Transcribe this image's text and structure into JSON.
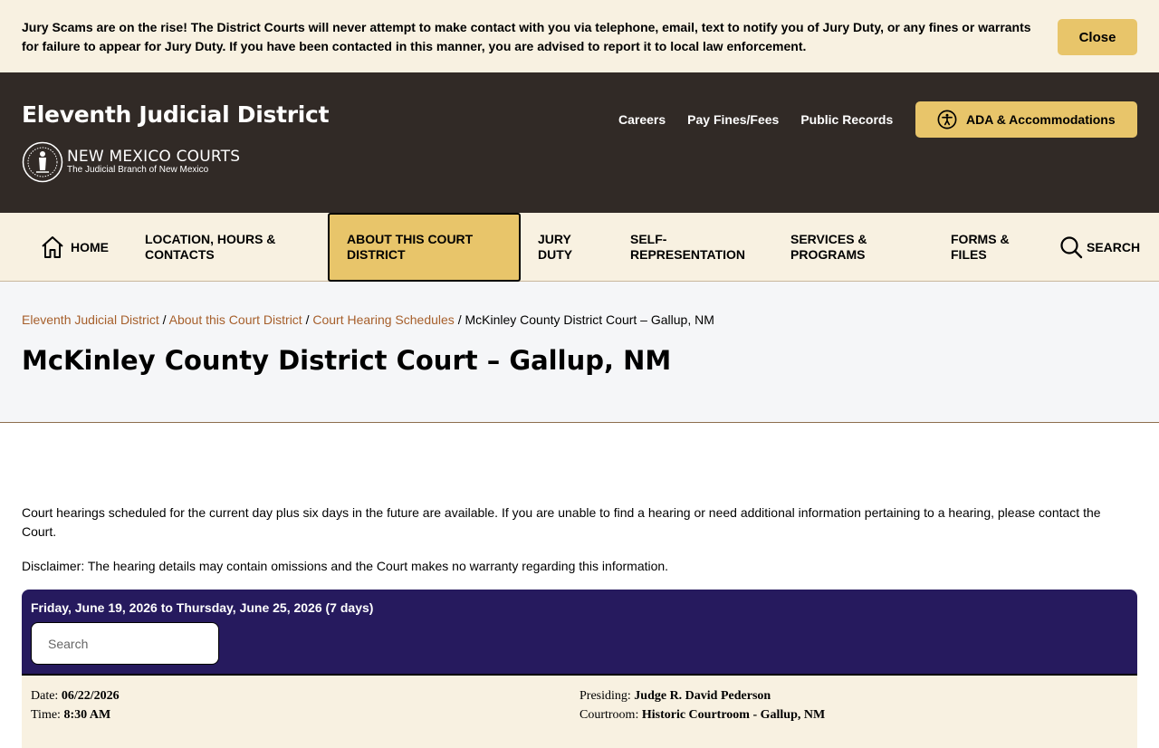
{
  "alert": {
    "message": "Jury Scams are on the rise! The District Courts will never attempt to make contact with you via telephone, email, text to notify you of Jury Duty, or any fines or warrants for failure to appear for Jury Duty. If you have been contacted in this manner, you are advised to report it to local law enforcement.",
    "close_label": "Close"
  },
  "header": {
    "site_title": "Eleventh Judicial District",
    "logo_line1": "NEW MEXICO COURTS",
    "logo_line2": "The Judicial Branch of New Mexico",
    "links": [
      "Careers",
      "Pay Fines/Fees",
      "Public Records"
    ],
    "ada_label": "ADA & Accommodations",
    "ada_icon": "accessibility-icon"
  },
  "nav": {
    "items": [
      {
        "label": "HOME",
        "icon": "home-icon"
      },
      {
        "label": "LOCATION, HOURS & CONTACTS"
      },
      {
        "label": "ABOUT THIS COURT DISTRICT",
        "active": true
      },
      {
        "label": "JURY DUTY"
      },
      {
        "label": "SELF-REPRESENTATION"
      },
      {
        "label": "SERVICES & PROGRAMS"
      },
      {
        "label": "FORMS & FILES"
      },
      {
        "label": "SEARCH",
        "icon": "search-icon"
      }
    ]
  },
  "breadcrumb": {
    "items": [
      "Eleventh Judicial District",
      "About this Court District",
      "Court Hearing Schedules"
    ],
    "current": "McKinley County District Court – Gallup, NM",
    "separator": "/"
  },
  "page_title": "McKinley County District Court – Gallup, NM",
  "content": {
    "intro": "Court hearings scheduled for the current day plus six days in the future are available. If you are unable to find a hearing or need additional information pertaining to a hearing, please contact the Court.",
    "disclaimer": "Disclaimer:  The hearing details may contain omissions and the Court makes no warranty regarding this information."
  },
  "schedule": {
    "range": "Friday, June 19, 2026 to Thursday, June 25, 2026 (7 days)",
    "search_placeholder": "Search",
    "hearing": {
      "date_label": "Date:",
      "date": "06/22/2026",
      "time_label": "Time:",
      "time": "8:30 AM",
      "presiding_label": "Presiding:",
      "presiding": "Judge R. David Pederson",
      "courtroom_label": "Courtroom:",
      "courtroom": "Historic Courtroom - Gallup, NM"
    }
  },
  "colors": {
    "alert_bg": "#f8f1e1",
    "header_bg": "#312a26",
    "accent_gold": "#e8c56a",
    "schedule_head": "#261a5e",
    "link_brown": "#a65f2b"
  }
}
